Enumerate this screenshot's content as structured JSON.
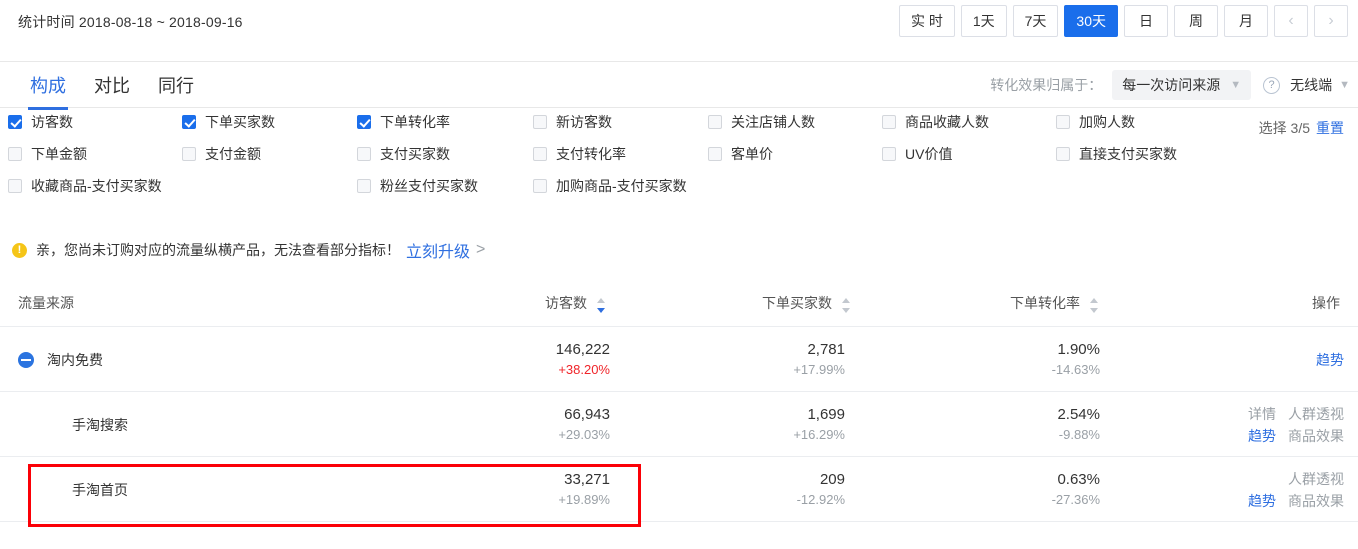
{
  "header": {
    "date_range_label": "统计时间 2018-08-18 ~ 2018-09-16",
    "periods": [
      {
        "label": "实 时",
        "active": false
      },
      {
        "label": "1天",
        "active": false
      },
      {
        "label": "7天",
        "active": false
      },
      {
        "label": "30天",
        "active": true
      },
      {
        "label": "日",
        "active": false
      },
      {
        "label": "周",
        "active": false
      },
      {
        "label": "月",
        "active": false
      }
    ],
    "prev_arrow": "‹",
    "next_arrow": "›"
  },
  "tabs": [
    {
      "label": "构成",
      "active": true
    },
    {
      "label": "对比",
      "active": false
    },
    {
      "label": "同行",
      "active": false
    }
  ],
  "attribution": {
    "label": "转化效果归属于：",
    "select_value": "每一次访问来源",
    "help_icon": "?",
    "terminal_value": "无线端",
    "caret": "∨"
  },
  "metrics": {
    "row1": [
      "访客数",
      "下单买家数",
      "下单转化率",
      "新访客数",
      "关注店铺人数",
      "商品收藏人数",
      "加购人数"
    ],
    "row1_checked": [
      true,
      true,
      true,
      false,
      false,
      false,
      false
    ],
    "row2": [
      "下单金额",
      "支付金额",
      "支付买家数",
      "支付转化率",
      "客单价",
      "UV价值",
      "直接支付买家数"
    ],
    "row3": [
      "收藏商品-支付买家数",
      "粉丝支付买家数",
      "加购商品-支付买家数"
    ],
    "select_count": "选择 3/5",
    "reset_label": "重置"
  },
  "notice": {
    "icon": "!",
    "text": "亲，您尚未订购对应的流量纵横产品，无法查看部分指标！",
    "link": "立刻升级",
    "arrow": ">"
  },
  "table": {
    "columns": [
      {
        "label": "流量来源",
        "sortable": false
      },
      {
        "label": "访客数",
        "sortable": true,
        "sorted": "desc"
      },
      {
        "label": "下单买家数",
        "sortable": true,
        "sorted": ""
      },
      {
        "label": "下单转化率",
        "sortable": true,
        "sorted": ""
      },
      {
        "label": "操作",
        "sortable": false
      }
    ],
    "rows": [
      {
        "source": "淘内免费",
        "level": 0,
        "expanded": true,
        "visitors": "146,222",
        "visitors_delta": "+38.20%",
        "visitors_delta_up": true,
        "buyers": "2,781",
        "buyers_delta": "+17.99%",
        "conv": "1.90%",
        "conv_delta": "-14.63%",
        "ops_line1": [],
        "ops_line2": [
          {
            "label": "趋势",
            "blue": true
          }
        ],
        "ops_single": "趋势",
        "highlight": false
      },
      {
        "source": "手淘搜索",
        "level": 1,
        "expanded": false,
        "visitors": "66,943",
        "visitors_delta": "+29.03%",
        "visitors_delta_up": false,
        "buyers": "1,699",
        "buyers_delta": "+16.29%",
        "conv": "2.54%",
        "conv_delta": "-9.88%",
        "ops_line1": [
          {
            "label": "详情",
            "blue": false
          },
          {
            "label": "人群透视",
            "blue": false
          }
        ],
        "ops_line2": [
          {
            "label": "趋势",
            "blue": true
          },
          {
            "label": "商品效果",
            "blue": false
          }
        ],
        "ops_single": "",
        "highlight": false
      },
      {
        "source": "手淘首页",
        "level": 1,
        "expanded": false,
        "visitors": "33,271",
        "visitors_delta": "+19.89%",
        "visitors_delta_up": false,
        "buyers": "209",
        "buyers_delta": "-12.92%",
        "conv": "0.63%",
        "conv_delta": "-27.36%",
        "ops_line1": [
          {
            "label": "人群透视",
            "blue": false
          }
        ],
        "ops_line2": [
          {
            "label": "趋势",
            "blue": true
          },
          {
            "label": "商品效果",
            "blue": false
          }
        ],
        "ops_single": "",
        "highlight": true
      }
    ]
  },
  "colors": {
    "accent": "#1a6eeb",
    "link": "#2f6fe0",
    "up": "#f0252a",
    "muted": "#9aa0a6",
    "highlight_box": "#fb0007"
  }
}
